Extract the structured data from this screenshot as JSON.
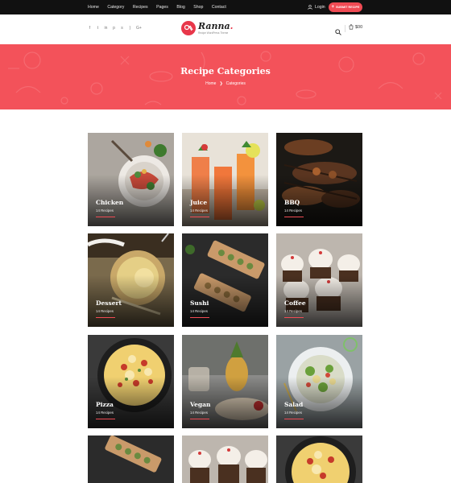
{
  "topnav": {
    "items": [
      "Home",
      "Category",
      "Recipes",
      "Pages",
      "Blog",
      "Shop",
      "Contact"
    ],
    "login": "Login",
    "submit": "SUBMIT RECIPE"
  },
  "header": {
    "social_icons": [
      "facebook-icon",
      "twitter-icon",
      "linkedin-icon",
      "pinterest-icon",
      "skype-icon",
      "rss-icon",
      "google-plus-icon"
    ],
    "logo_name": "Ranna",
    "logo_tagline": "Recipe WordPress Theme",
    "cart_total": "$00"
  },
  "banner": {
    "title": "Recipe Categories",
    "breadcrumb_home": "Home",
    "breadcrumb_current": "Categories"
  },
  "categories": [
    {
      "name": "Chicken",
      "count": "14 Recipes"
    },
    {
      "name": "Juice",
      "count": "14 Recipes"
    },
    {
      "name": "BBQ",
      "count": "14 Recipes"
    },
    {
      "name": "Dessert",
      "count": "14 Recipes"
    },
    {
      "name": "Sushi",
      "count": "14 Recipes"
    },
    {
      "name": "Coffee",
      "count": "14 Recipes"
    },
    {
      "name": "Pizza",
      "count": "14 Recipes"
    },
    {
      "name": "Vegan",
      "count": "14 Recipes"
    },
    {
      "name": "Salad",
      "count": "14 Recipes"
    }
  ],
  "colors": {
    "accent": "#f04b54",
    "banner": "#f3525a",
    "topbar": "#111111"
  }
}
